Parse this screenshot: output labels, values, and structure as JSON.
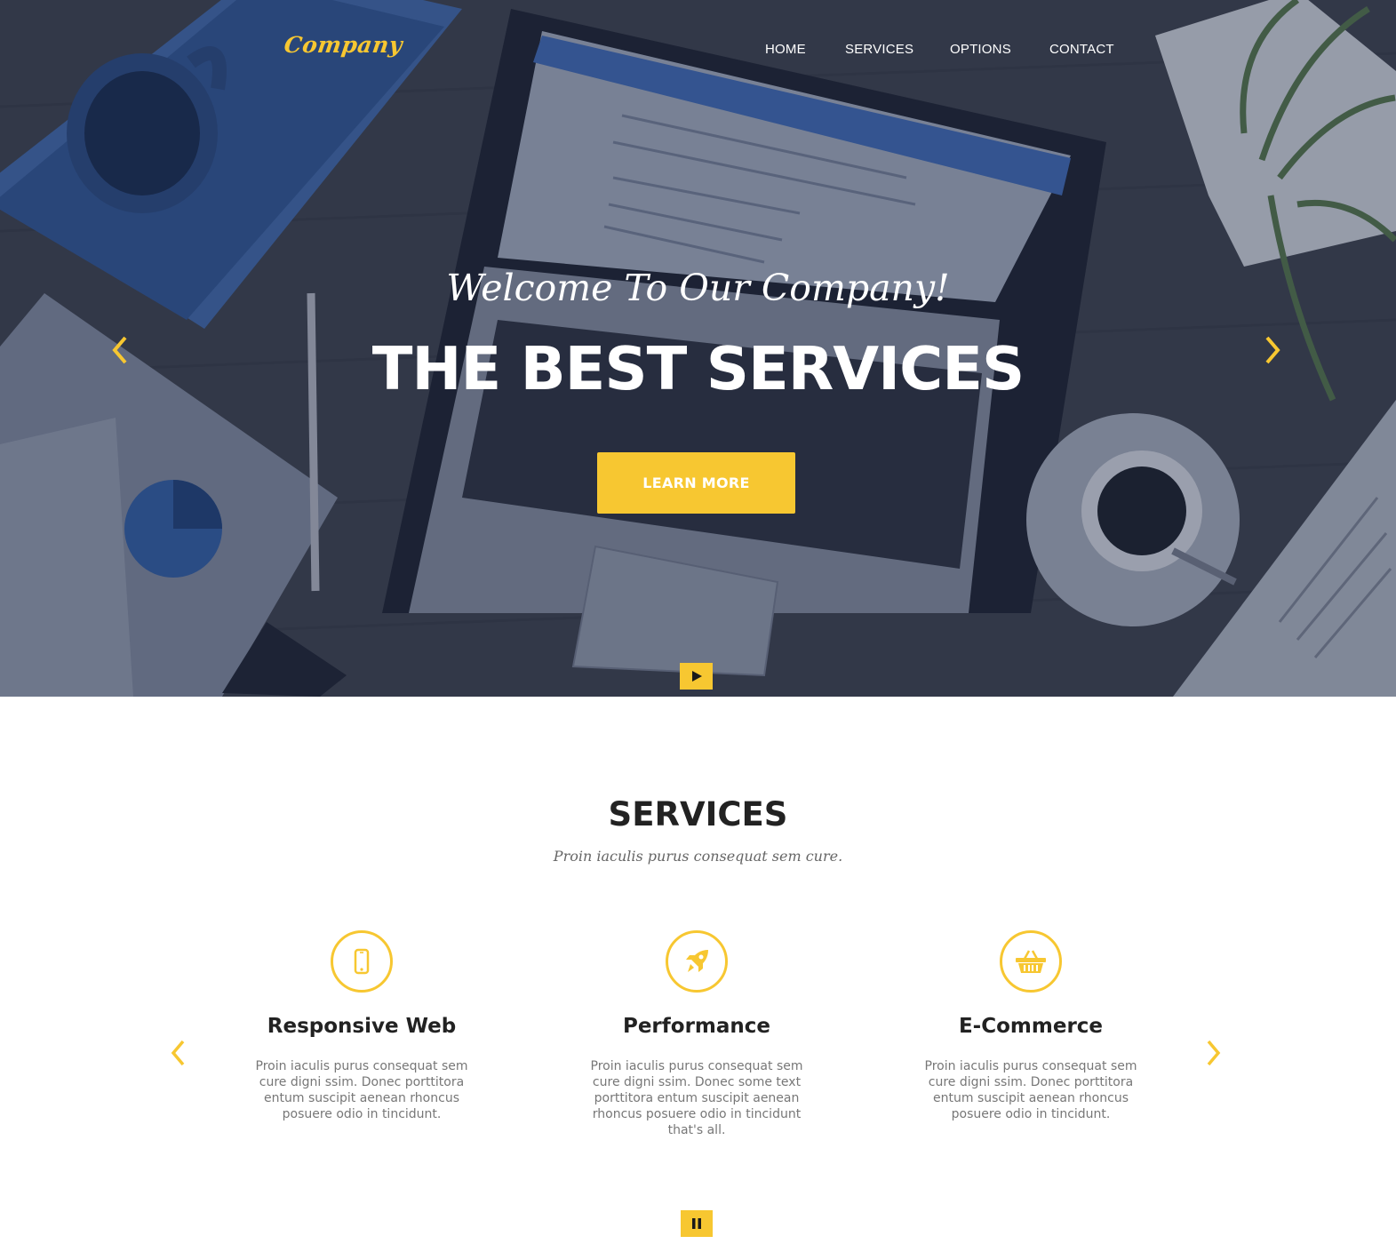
{
  "colors": {
    "accent": "#f7c731",
    "hero_overlay": "#2c3447",
    "heading": "#222222",
    "body_text": "#777777"
  },
  "header": {
    "logo": "Company",
    "nav": [
      "HOME",
      "SERVICES",
      "OPTIONS",
      "CONTACT"
    ]
  },
  "hero": {
    "welcome": "Welcome To Our Company!",
    "headline": "THE BEST SERVICES",
    "cta_label": "LEARN MORE",
    "prev_icon": "chevron-left-icon",
    "next_icon": "chevron-right-icon",
    "play_icon": "play-icon"
  },
  "services": {
    "title": "SERVICES",
    "subtitle": "Proin iaculis purus consequat sem cure.",
    "items": [
      {
        "icon": "mobile-phone-icon",
        "title": "Responsive Web",
        "text": "Proin iaculis purus consequat sem cure digni ssim. Donec porttitora entum suscipit aenean rhoncus posuere odio in tincidunt."
      },
      {
        "icon": "rocket-icon",
        "title": "Performance",
        "text": "Proin iaculis purus consequat sem cure digni ssim. Donec some text porttitora entum suscipit aenean rhoncus posuere odio in tincidunt that's all."
      },
      {
        "icon": "shopping-basket-icon",
        "title": "E-Commerce",
        "text": "Proin iaculis purus consequat sem cure digni ssim. Donec porttitora entum suscipit aenean rhoncus posuere odio in tincidunt."
      }
    ],
    "prev_icon": "chevron-left-icon",
    "next_icon": "chevron-right-icon",
    "pause_icon": "pause-icon"
  }
}
